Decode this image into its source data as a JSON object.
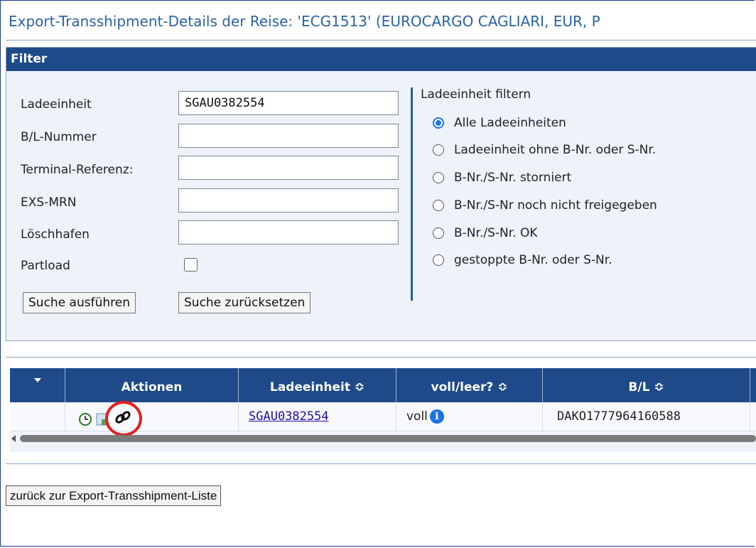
{
  "title": "Export-Transshipment-Details der Reise: 'ECG1513' (EUROCARGO CAGLIARI, EUR, P",
  "filter": {
    "heading": "Filter",
    "fields": [
      {
        "label": "Ladeeinheit",
        "value": "SGAU0382554"
      },
      {
        "label": "B/L-Nummer",
        "value": ""
      },
      {
        "label": "Terminal-Referenz:",
        "value": ""
      },
      {
        "label": "EXS-MRN",
        "value": ""
      },
      {
        "label": "Löschhafen",
        "value": ""
      }
    ],
    "partload_label": "Partload",
    "partload_checked": false,
    "search_button": "Suche ausführen",
    "reset_button": "Suche zurücksetzen",
    "radio_title": "Ladeeinheit filtern",
    "radio_options": [
      "Alle Ladeeinheiten",
      "Ladeeinheit ohne B-Nr. oder S-Nr.",
      "B-Nr./S-Nr. storniert",
      "B-Nr./S-Nr noch nicht freigegeben",
      "B-Nr./S-Nr. OK",
      "gestoppte B-Nr. oder S-Nr."
    ],
    "radio_selected": 0
  },
  "grid": {
    "columns": [
      "Aktionen",
      "Ladeeinheit ≎",
      "voll/leer? ≎",
      "B/L ≎"
    ],
    "row": {
      "actions": [
        "clock-icon",
        "document-icon",
        "link-icon"
      ],
      "ladeeinheit": "SGAU0382554",
      "voll_leer": "voll",
      "bl": "DAKO1777964160588"
    }
  },
  "back_button": "zurück zur Export-Transshipment-Liste",
  "colors": {
    "header_blue": "#1e4a8a",
    "title_blue": "#2a63a8",
    "highlight_red": "#e02020"
  }
}
